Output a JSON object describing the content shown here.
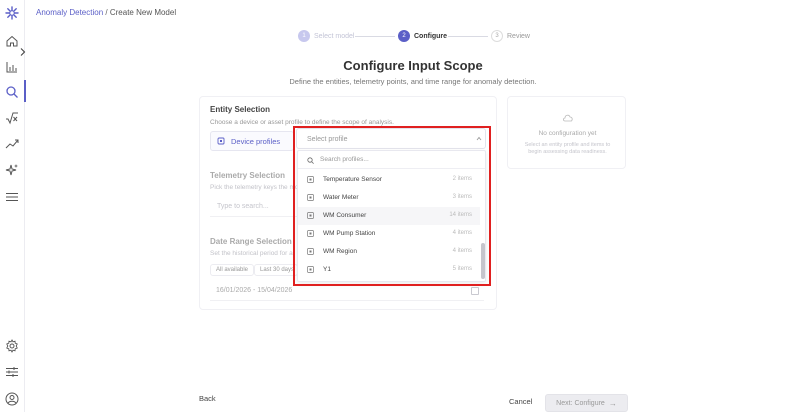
{
  "breadcrumb": {
    "parent": "Anomaly Detection",
    "separator": "/",
    "current": "Create New Model"
  },
  "stepper": [
    {
      "number": "1",
      "label": "Select model"
    },
    {
      "number": "2",
      "label": "Configure"
    },
    {
      "number": "3",
      "label": "Review"
    }
  ],
  "header": {
    "title": "Configure Input Scope",
    "subtitle": "Define the entities, telemetry points, and time range for anomaly detection."
  },
  "entity_selection": {
    "title": "Entity Selection",
    "description": "Choose a device or asset profile to define the scope of analysis.",
    "type_button": "Device profiles",
    "select_placeholder": "Select profile"
  },
  "telemetry_selection": {
    "title": "Telemetry Selection",
    "description": "Pick the telemetry keys the mo",
    "input_placeholder": "Type to search..."
  },
  "date_range": {
    "title": "Date Range Selection",
    "description": "Set the historical period for a",
    "chips": [
      "All available",
      "Last 30 days"
    ],
    "value": "16/01/2026 - 15/04/2026"
  },
  "dropdown": {
    "search_placeholder": "Search profiles...",
    "items": [
      {
        "name": "Temperature Sensor",
        "count": "2 items"
      },
      {
        "name": "Water Meter",
        "count": "3 items"
      },
      {
        "name": "WM Consumer",
        "count": "14 items"
      },
      {
        "name": "WM Pump Station",
        "count": "4 items"
      },
      {
        "name": "WM Region",
        "count": "4 items"
      },
      {
        "name": "Y1",
        "count": "5 items"
      }
    ]
  },
  "side_panel": {
    "title": "No configuration yet",
    "description": "Select an entity profile and items to begin assessing data readiness."
  },
  "footer": {
    "back_label": "Back",
    "cancel_label": "Cancel",
    "next_label": "Next: Configure"
  },
  "colors": {
    "accent": "#5b5fc7",
    "highlight_outline": "#e02020"
  },
  "icons": [
    "logo-icon",
    "home-icon",
    "chart-icon",
    "search-icon",
    "function-icon",
    "trend-icon",
    "sparkle-icon",
    "menu-icon",
    "gear-icon",
    "sliders-icon",
    "user-icon"
  ]
}
